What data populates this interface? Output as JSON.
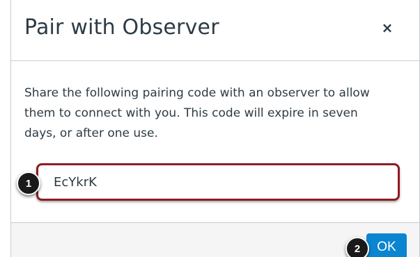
{
  "dialog": {
    "title": "Pair with Observer",
    "close_label": "×",
    "description": "Share the following pairing code with an observer to allow them to connect with you. This code will expire in seven days, or after one use.",
    "pairing_code": {
      "value": "EcYkrK"
    },
    "ok_label": "OK"
  },
  "callouts": {
    "first": "1",
    "second": "2"
  },
  "colors": {
    "input_border": "#8e1b23",
    "ok_button": "#0c85d0",
    "text": "#2d3b45",
    "footer_bg": "#f5f5f5"
  }
}
